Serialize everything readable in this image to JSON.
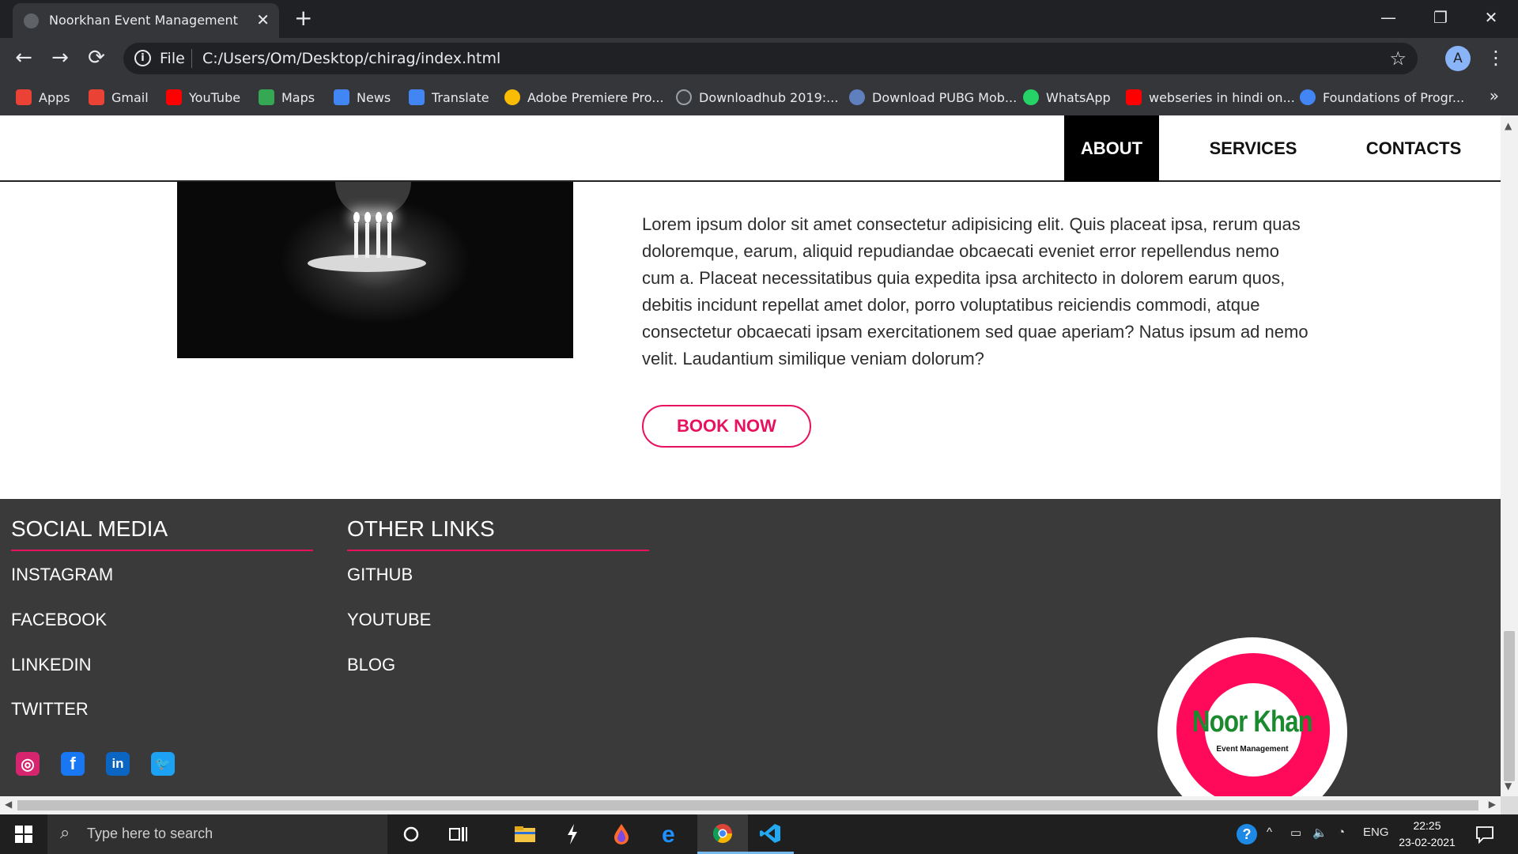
{
  "browser": {
    "tab_title": "Noorkhan Event Management",
    "close_symbol": "✕",
    "new_tab_symbol": "+",
    "window_controls": {
      "minimize": "—",
      "restore": "❐",
      "close": "✕"
    },
    "nav": {
      "back": "←",
      "forward": "→",
      "reload": "⟳"
    },
    "address": {
      "scheme": "File",
      "url": "C:/Users/Om/Desktop/chirag/index.html",
      "star": "☆"
    },
    "profile_initial": "A",
    "menu_symbol": "⋮",
    "bookmarks": [
      {
        "label": "Apps",
        "icon": "apps-grid-icon",
        "color": "#ea4335"
      },
      {
        "label": "Gmail",
        "icon": "gmail-icon",
        "color": "#ea4335"
      },
      {
        "label": "YouTube",
        "icon": "youtube-icon",
        "color": "#ff0000"
      },
      {
        "label": "Maps",
        "icon": "maps-icon",
        "color": "#34a853"
      },
      {
        "label": "News",
        "icon": "news-icon",
        "color": "#4285f4"
      },
      {
        "label": "Translate",
        "icon": "translate-icon",
        "color": "#4285f4"
      },
      {
        "label": "Adobe Premiere Pro...",
        "icon": "google-g-icon",
        "color": "#fbbc05"
      },
      {
        "label": "Downloadhub 2019:...",
        "icon": "downloadhub-icon",
        "color": "#3c4043"
      },
      {
        "label": "Download PUBG Mob...",
        "icon": "pubg-icon",
        "color": "#5f7fbf"
      },
      {
        "label": "WhatsApp",
        "icon": "whatsapp-icon",
        "color": "#25d366"
      },
      {
        "label": "webseries in hindi on...",
        "icon": "youtube-icon",
        "color": "#ff0000"
      },
      {
        "label": "Foundations of Progr...",
        "icon": "google-icon",
        "color": "#4285f4"
      }
    ],
    "bookmarks_more": "»"
  },
  "page": {
    "nav": {
      "about": "ABOUT",
      "services": "SERVICES",
      "contacts": "CONTACTS"
    },
    "about": {
      "text": "Lorem ipsum dolor sit amet consectetur adipisicing elit. Quis placeat ipsa, rerum quas doloremque, earum, aliquid repudiandae obcaecati eveniet error repellendus nemo cum a. Placeat necessitatibus quia expedita ipsa architecto in dolorem earum quos, debitis incidunt repellat amet dolor, porro voluptatibus reiciendis commodi, atque consectetur obcaecati ipsam exercitationem sed quae aperiam? Natus ipsum ad nemo velit. Laudantium similique veniam dolorum?",
      "button": "BOOK NOW"
    },
    "footer": {
      "social_heading": "SOCIAL MEDIA",
      "social_links": [
        "INSTAGRAM",
        "FACEBOOK",
        "LINKEDIN",
        "TWITTER"
      ],
      "other_heading": "OTHER LINKS",
      "other_links": [
        "GITHUB",
        "YOUTUBE",
        "BLOG"
      ],
      "social_icons": [
        {
          "icon": "instagram-icon",
          "glyph": "◎",
          "color": "#d6246e"
        },
        {
          "icon": "facebook-icon",
          "glyph": "f",
          "color": "#1877f2"
        },
        {
          "icon": "linkedin-icon",
          "glyph": "in",
          "color": "#0a66c2"
        },
        {
          "icon": "twitter-icon",
          "glyph": "🐦",
          "color": "#1da1f2"
        }
      ],
      "logo": {
        "brand": "Noor Khan",
        "subtitle": "Event Management"
      }
    },
    "colors": {
      "accent": "#e8115f",
      "footer_bg": "#3a3a3a",
      "logo_green": "#1b8a2f"
    }
  },
  "taskbar": {
    "search_placeholder": "Type here to search",
    "tray": {
      "language": "ENG",
      "time": "22:25",
      "date": "23-02-2021"
    }
  }
}
